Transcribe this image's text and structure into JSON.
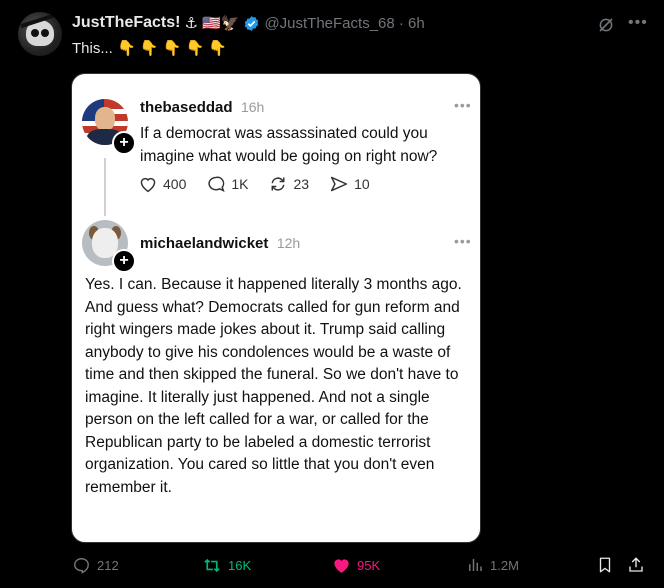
{
  "author": {
    "display_name": "JustTheFacts!",
    "emojis": "⚓ 🇺🇸🦅",
    "handle": "@JustTheFacts_68 · 6h"
  },
  "tweet": {
    "text": "This... 👇 👇 👇 👇 👇"
  },
  "screenshot": {
    "post1": {
      "username": "thebaseddad",
      "time": "16h",
      "text": "If a democrat was assassinated could you imagine what would be going on right now?",
      "likes": "400",
      "replies": "1K",
      "reposts": "23",
      "shares": "10"
    },
    "post2": {
      "username": "michaelandwicket",
      "time": "12h",
      "text": "Yes. I can. Because it happened literally 3 months ago. And guess what? Democrats called for gun reform and right wingers made jokes about it. Trump said calling anybody to give his condolences would be a waste of time and then skipped the funeral. So we don't have to imagine. It literally just happened. And not a single person on the left called for a war, or called for the Republican party to be labeled a domestic terrorist organization. You cared so little that you don't even remember it."
    },
    "more_glyph": "•••",
    "plus_glyph": "+"
  },
  "stats": {
    "replies": "212",
    "reposts": "16K",
    "likes": "95K",
    "views": "1.2M"
  },
  "icons": {
    "top_more": "more-icon",
    "grok": "grok-icon",
    "reply": "reply-icon",
    "repost": "repost-icon",
    "like": "heart-icon",
    "views": "views-icon",
    "bookmark": "bookmark-icon",
    "share": "share-icon"
  },
  "colors": {
    "background": "#000000",
    "text": "#e7e9ea",
    "muted": "#71767b",
    "repost": "#00ba7c",
    "like": "#f91880",
    "verified": "#1d9bf0"
  }
}
